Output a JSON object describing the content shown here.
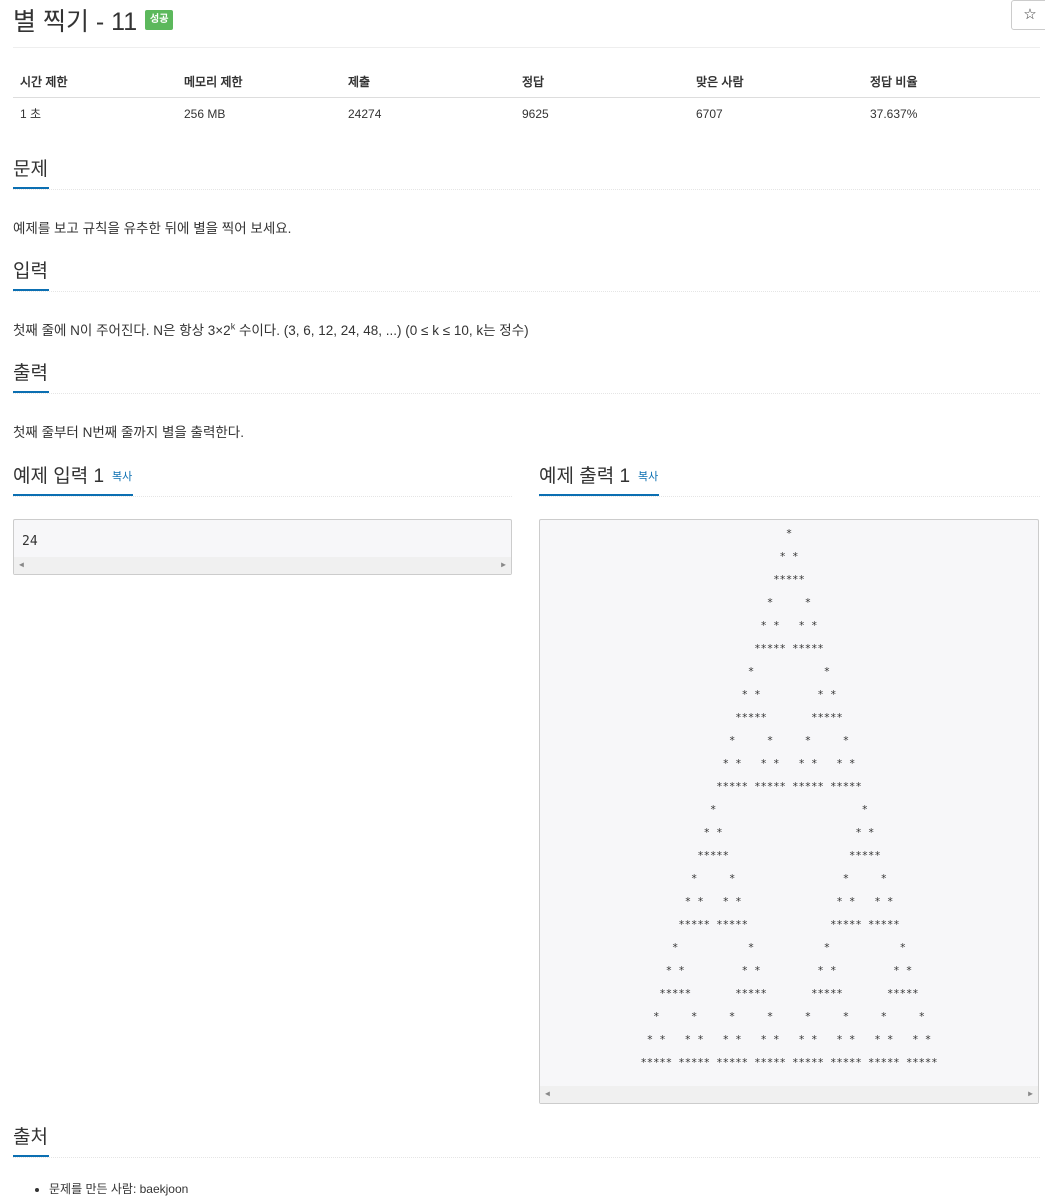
{
  "problem": {
    "title": "별 찍기 - 11",
    "badge": "성공",
    "star_button": "☆"
  },
  "info_table": {
    "headers": [
      "시간 제한",
      "메모리 제한",
      "제출",
      "정답",
      "맞은 사람",
      "정답 비율"
    ],
    "values": [
      "1 초",
      "256 MB",
      "24274",
      "9625",
      "6707",
      "37.637%"
    ]
  },
  "sections": {
    "problem_label": "문제",
    "problem_text": "예제를 보고 규칙을 유추한 뒤에 별을 찍어 보세요.",
    "input_label": "입력",
    "input_text_before": "첫째 줄에 N이 주어진다. N은 항상 3×2",
    "input_text_sup": "k",
    "input_text_after": " 수이다. (3, 6, 12, 24, 48, ...) (0 ≤ k ≤ 10, k는 정수)",
    "output_label": "출력",
    "output_text": "첫째 줄부터 N번째 줄까지 별을 출력한다.",
    "sample_input_label": "예제 입력 1",
    "sample_output_label": "예제 출력 1",
    "copy_label": "복사",
    "sample_input": "24",
    "source_label": "출처",
    "source_item": "문제를 만든 사람: baekjoon"
  },
  "sample_output_rows": [
    "*",
    "* *",
    "*****",
    "*     *",
    "* *   * *",
    "***** *****",
    "*           *",
    "* *         * *",
    "*****       *****",
    "*     *     *     *",
    "* *   * *   * *   * *",
    "***** ***** ***** *****",
    "*                       *",
    "* *                     * *",
    "*****                   *****",
    "*     *                 *     *",
    "* *   * *               * *   * *",
    "***** *****             ***** *****",
    "*           *           *           *",
    "* *         * *         * *         * *",
    "*****       *****       *****       *****",
    "*     *     *     *     *     *     *     *",
    "* *   * *   * *   * *   * *   * *   * *   * *",
    "***** ***** ***** ***** ***** ***** ***** *****"
  ]
}
